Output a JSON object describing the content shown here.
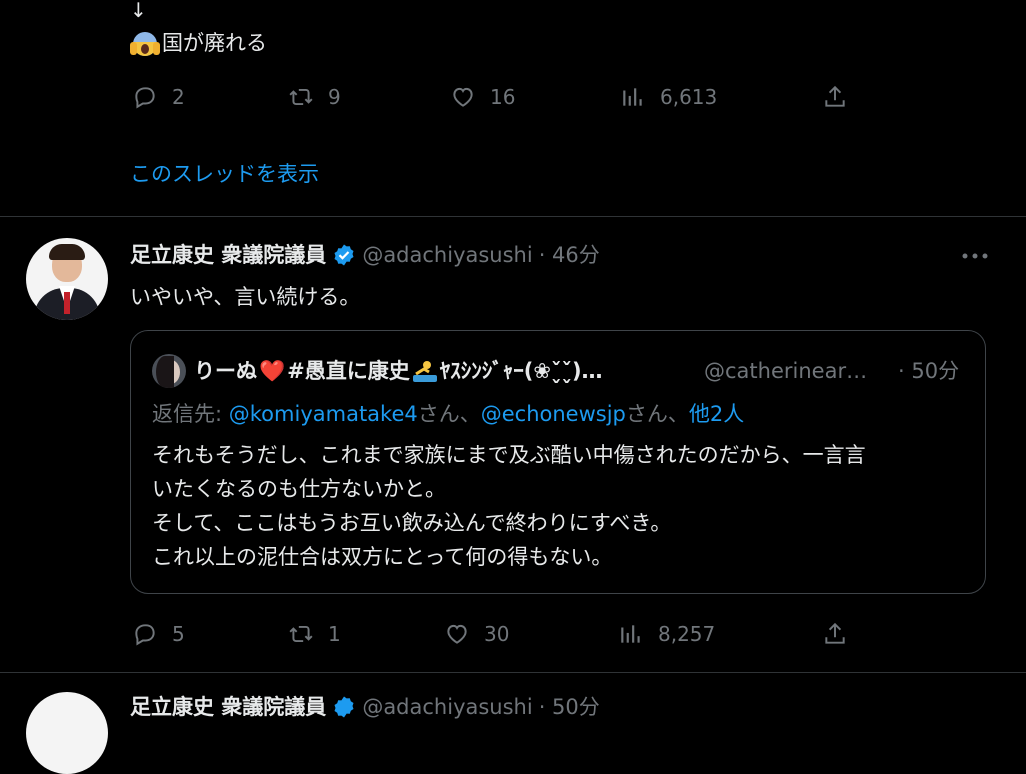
{
  "prev_tweet": {
    "arrow": "↓",
    "emoji": "scream-emoji",
    "text": "国が廃れる",
    "stats": {
      "replies": "2",
      "retweets": "9",
      "likes": "16",
      "views": "6,613"
    },
    "thread_link": "このスレッドを表示"
  },
  "tweet": {
    "name": "足立康史 衆議院議員",
    "handle": "@adachiyasushi",
    "time": "· 46分",
    "text": "いやいや、言い続ける。",
    "stats": {
      "replies": "5",
      "retweets": "1",
      "likes": "30",
      "views": "8,257"
    }
  },
  "quote": {
    "name_part1": "りーぬ",
    "heart": "❤️",
    "name_part2": " #愚直に康史",
    "name_part3": "ﾔｽｼﾝｼﾞｬｰ(❀ˇ̬ˇ̬)…",
    "handle": "@catherinear…",
    "time": "· 50分",
    "reply_prefix": "返信先: ",
    "reply_to_1": "@komiyamatake4",
    "reply_mid_1": "さん、",
    "reply_to_2": "@echonewsjp",
    "reply_mid_2": "さん、",
    "reply_to_3": "他2人",
    "body": [
      "それもそうだし、これまで家族にまで及ぶ酷い中傷されたのだから、一言言",
      "いたくなるのも仕方ないかと。",
      "そして、ここはもうお互い飲み込んで終わりにすべき。",
      "これ以上の泥仕合は双方にとって何の得もない。"
    ]
  },
  "next_tweet": {
    "name": "足立康史 衆議院議員",
    "handle": "@adachiyasushi",
    "time": "· 50分"
  },
  "colors": {
    "background": "#000000",
    "text": "#e7e9ea",
    "muted": "#71767b",
    "accent": "#1d9bf0",
    "border": "#2f3336",
    "verified": "#1d9bf0"
  }
}
